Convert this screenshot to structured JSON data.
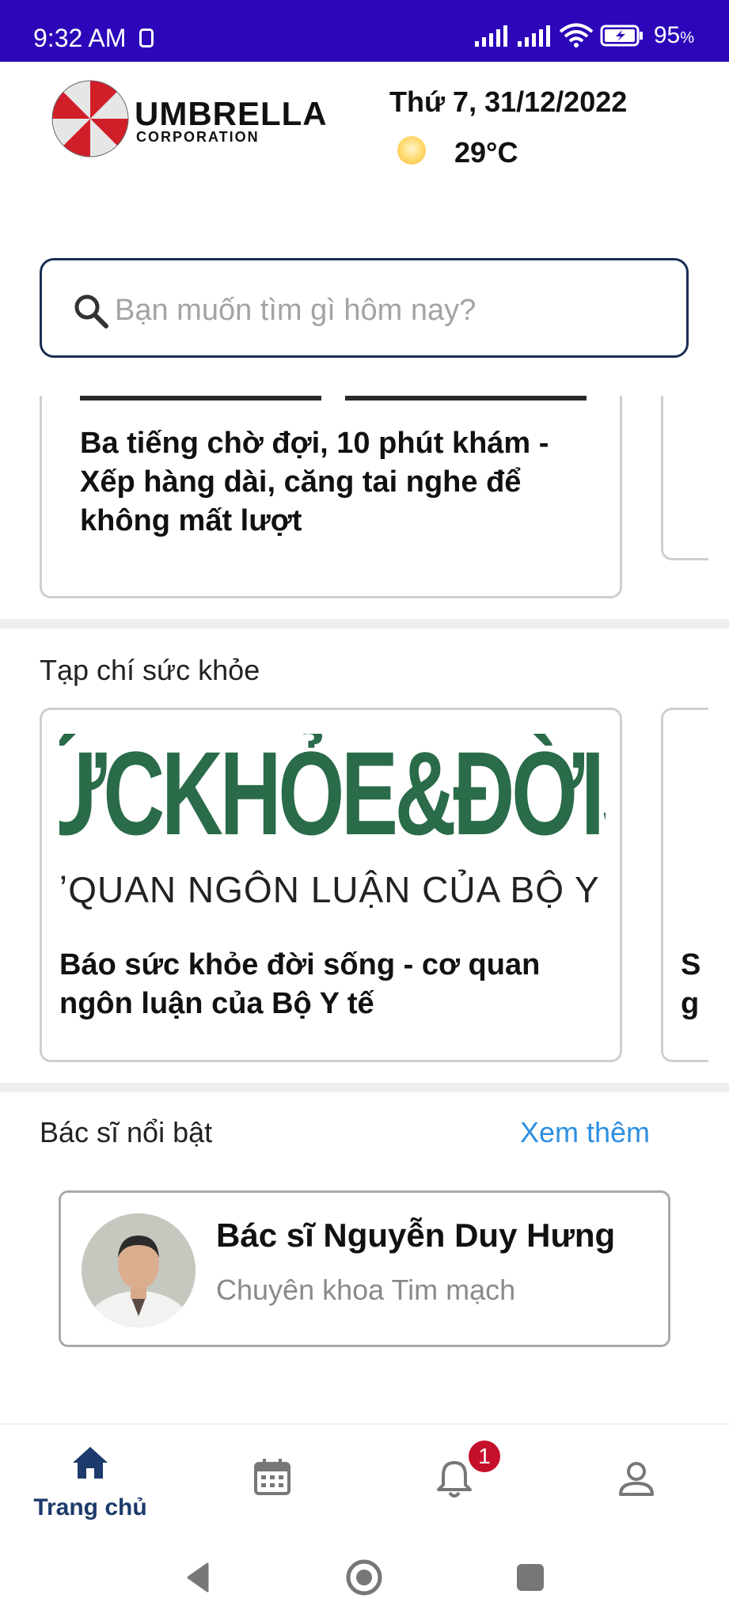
{
  "status_bar": {
    "time": "9:32 AM",
    "battery_percent": "95",
    "battery_unit": "%"
  },
  "header": {
    "logo_title": "UMBRELLA",
    "logo_subtitle": "CORPORATION",
    "date": "Thứ 7, 31/12/2022",
    "temperature": "29°C",
    "weather_icon": "sun-icon"
  },
  "search": {
    "placeholder": "Bạn muốn tìm gì hôm nay?"
  },
  "news": {
    "card_title": "Ba tiếng chờ đợi, 10 phút khám - Xếp hàng dài, căng tai nghe để không mất lượt"
  },
  "magazine": {
    "section_title": "Tạp chí sức khỏe",
    "banner_big": "ỨCKHỎE&ĐỜISỐN",
    "banner_sub": "QUAN NGÔN LUẬN CỦA BỘ Y",
    "card_title": "Báo sức khỏe đời sống - cơ quan ngôn luận của Bộ Y tế",
    "peek_text": "S\ng"
  },
  "doctors": {
    "section_title": "Bác sĩ nổi bật",
    "see_more": "Xem thêm",
    "featured": {
      "name": "Bác sĩ Nguyễn Duy Hưng",
      "specialty": "Chuyên khoa Tim mạch"
    }
  },
  "bottom_nav": {
    "home_label": "Trang chủ",
    "notification_count": "1"
  },
  "colors": {
    "status_bar": "#2c06b8",
    "primary_navy": "#1c3a6b",
    "link_blue": "#2d8fe0",
    "badge_red": "#c4102a",
    "magazine_green": "#2a6b49"
  }
}
